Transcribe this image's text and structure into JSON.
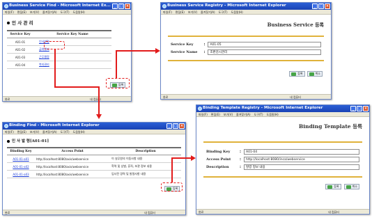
{
  "w1": {
    "title": "Business Service Find - Microsoft Internet Ex...",
    "menu": [
      "파일(F)",
      "편집(E)",
      "보기(V)",
      "즐겨찾기(A)",
      "도구(T)",
      "도움말(H)"
    ],
    "heading": "인 사 관 리",
    "col_key": "Service Key",
    "col_name": "Service Key Name",
    "rows": [
      {
        "key": "A01-01",
        "name": "인사발령"
      },
      {
        "key": "A01-02",
        "name": "급여관리"
      },
      {
        "key": "A01-03",
        "name": "근무평정"
      },
      {
        "key": "A01-04",
        "name": "복지관리"
      }
    ],
    "register_btn": "등록",
    "status_left": "완료",
    "status_zone": "내 컴퓨터"
  },
  "w2": {
    "title": "Business Service Registry - Microsoft Internet Explorer",
    "menu": [
      "파일(F)",
      "편집(E)",
      "보기(V)",
      "즐겨찾기(A)",
      "도구(T)",
      "도움말(H)"
    ],
    "panel_title": "Business Service 등록",
    "service_key_label": "Service Key",
    "service_key_value": "A01-05",
    "service_name_label": "Service Name",
    "service_name_value": "조판감시관리",
    "register_btn": "등록",
    "cancel_btn": "취소",
    "status_left": "완료",
    "status_zone": "내 컴퓨터"
  },
  "w3": {
    "title": "Binding Find - Microsoft Internet Explorer",
    "menu": [
      "파일(F)",
      "편집(E)",
      "보기(V)",
      "즐겨찾기(A)",
      "도구(T)",
      "도움말(H)"
    ],
    "heading": "인 사 발 령[A01-01]",
    "col_key": "Binding Key",
    "col_ap": "Access Point",
    "col_desc": "Description",
    "rows": [
      {
        "key": "A01-01-a01",
        "ap": "http://localhost:8080/axis/webservice",
        "desc": "이 실무원의 이동사항 내용"
      },
      {
        "key": "A01-01-a02",
        "ap": "http://localhost:8080/axis/webservice",
        "desc": "학력 및 상벌, 휴직, 보관 정보 내용"
      },
      {
        "key": "A01-01-a03",
        "ap": "http://localhost:8080/axis/webservice",
        "desc": "입사전 경력 및 발령사항 내용"
      }
    ],
    "register_btn": "등록",
    "status_left": "완료",
    "status_zone": "내 컴퓨터"
  },
  "w4": {
    "title": "Binding Template Registry - Microsoft Internet Explorer",
    "menu": [
      "파일(F)",
      "편집(E)",
      "보기(V)",
      "즐겨찾기(A)",
      "도구(T)",
      "도움말(H)"
    ],
    "panel_title": "Binding Template 등록",
    "binding_key_label": "Binding Key",
    "binding_key_value": "A01-04",
    "access_point_label": "Access Point",
    "access_point_value": "http://localhost:8080/inca/webservice",
    "description_label": "Description",
    "description_value": "발령 정보 내용",
    "register_btn": "등록",
    "cancel_btn": "취소",
    "status_left": "완료",
    "status_zone": "내 컴퓨터"
  },
  "colors": {
    "highlight": "#e21b1b",
    "titlebar": "#1f4fc8",
    "form_rule": "#e0b23a",
    "link": "#1b3cd8"
  }
}
